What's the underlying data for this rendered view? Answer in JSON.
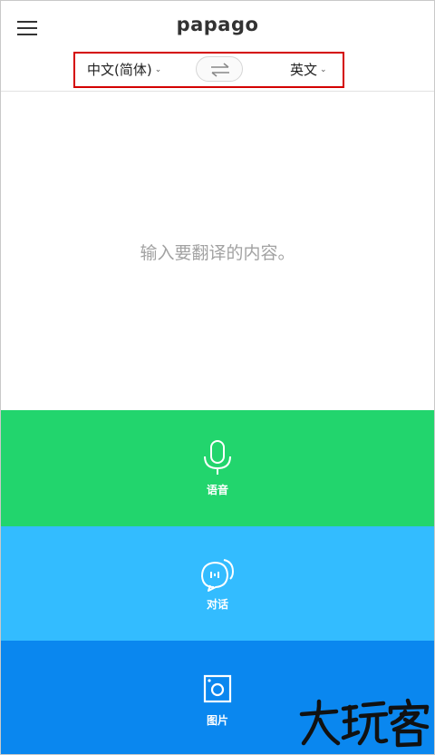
{
  "header": {
    "logo": "papago",
    "menu_icon": "hamburger-menu-icon"
  },
  "languages": {
    "source": "中文(简体)",
    "target": "英文",
    "swap_icon": "swap-arrows-icon"
  },
  "input": {
    "placeholder": "输入要翻译的内容。"
  },
  "actions": [
    {
      "label": "语音",
      "icon": "microphone-icon",
      "color": "#22d56d"
    },
    {
      "label": "对话",
      "icon": "conversation-bubble-icon",
      "color": "#33bcff"
    },
    {
      "label": "图片",
      "icon": "camera-frame-icon",
      "color": "#0a87ef"
    }
  ],
  "watermark": {
    "text": "大玩客"
  }
}
